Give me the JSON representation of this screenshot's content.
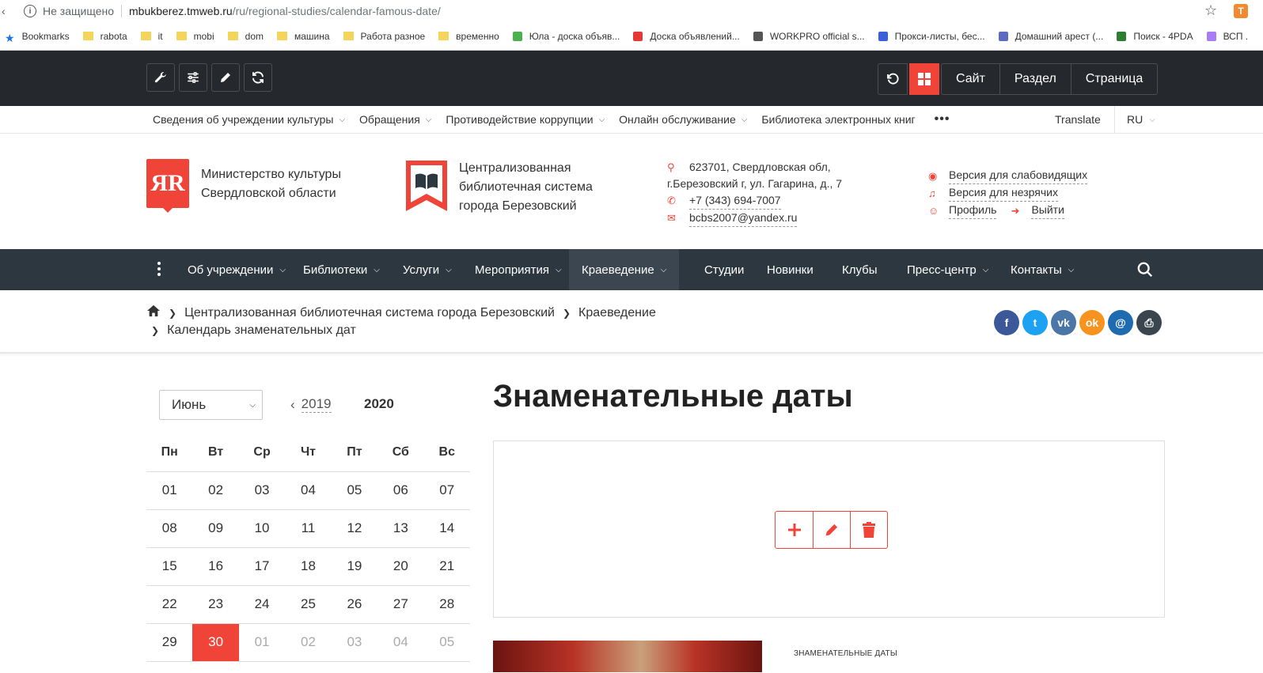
{
  "browser": {
    "insecure_label": "Не защищено",
    "url_host": "mbukberez.tmweb.ru",
    "url_path": "/ru/regional-studies/calendar-famous-date/",
    "extension_label": "T",
    "bookmarks": [
      {
        "label": "Bookmarks",
        "icon": "star-icon"
      },
      {
        "label": "rabota",
        "icon": "folder-icon"
      },
      {
        "label": "it",
        "icon": "folder-icon"
      },
      {
        "label": "mobi",
        "icon": "folder-icon"
      },
      {
        "label": "dom",
        "icon": "folder-icon"
      },
      {
        "label": "машина",
        "icon": "folder-icon"
      },
      {
        "label": "Работа разное",
        "icon": "folder-icon"
      },
      {
        "label": "временно",
        "icon": "folder-icon"
      },
      {
        "label": "Юла - доска объяв...",
        "icon": "sparkle-icon"
      },
      {
        "label": "Доска объявлений...",
        "icon": "dots-icon"
      },
      {
        "label": "WORKPRO official s...",
        "icon": "shield-icon"
      },
      {
        "label": "Прокси-листы, бес...",
        "icon": "badge-icon"
      },
      {
        "label": "Домашний арест (...",
        "icon": "bird-icon"
      },
      {
        "label": "Поиск - 4PDA",
        "icon": "doc-icon"
      },
      {
        "label": "ВСП .",
        "icon": "green-icon"
      }
    ]
  },
  "admin": {
    "seg_buttons": [
      "Сайт",
      "Раздел",
      "Страница"
    ]
  },
  "top_menu": {
    "items": [
      "Сведения об учреждении культуры",
      "Обращения",
      "Противодействие коррупции",
      "Онлайн обслуживание"
    ],
    "ebooks": "Библиотека электронных книг",
    "more": "•••",
    "translate": "Translate",
    "lang": "RU"
  },
  "header": {
    "logo_letters": "ЯR",
    "ministry_line1": "Министерство культуры",
    "ministry_line2": "Свердловской области",
    "cls_line1": "Централизованная",
    "cls_line2": "библиотечная система",
    "cls_line3": "города Березовский",
    "address_line1": "623701, Свердловская обл,",
    "address_line2": "г.Березовский г, ул. Гагарина, д., 7",
    "phone": "+7 (343) 694-7007",
    "email": "bcbs2007@yandex.ru",
    "low_vision": "Версия для слабовидящих",
    "hearing": "Версия для незрячих",
    "profile": "Профиль",
    "logout": "Выйти"
  },
  "nav": {
    "items": [
      {
        "label": "Об учреждении",
        "dropdown": true
      },
      {
        "label": "Библиотеки",
        "dropdown": true
      },
      {
        "label": "Услуги",
        "dropdown": true
      },
      {
        "label": "Мероприятия",
        "dropdown": true
      },
      {
        "label": "Краеведение",
        "dropdown": true,
        "active": true
      },
      {
        "label": "Студии",
        "dropdown": false
      },
      {
        "label": "Новинки",
        "dropdown": false
      },
      {
        "label": "Клубы",
        "dropdown": false
      },
      {
        "label": "Пресс-центр",
        "dropdown": true
      },
      {
        "label": "Контакты",
        "dropdown": true
      }
    ]
  },
  "breadcrumbs": {
    "level1": "Централизованная библиотечная система города Березовский",
    "level2": "Краеведение",
    "current": "Календарь знаменательных дат"
  },
  "share": [
    {
      "icon": "facebook-icon",
      "glyph": "f",
      "color": "#3b5998"
    },
    {
      "icon": "twitter-icon",
      "glyph": "t",
      "color": "#1da1f2"
    },
    {
      "icon": "vk-icon",
      "glyph": "vk",
      "color": "#4a76a8"
    },
    {
      "icon": "odnoklassniki-icon",
      "glyph": "ok",
      "color": "#f7931e"
    },
    {
      "icon": "mail-icon",
      "glyph": "@",
      "color": "#1f6bb0"
    },
    {
      "icon": "print-icon",
      "glyph": "⎙",
      "color": "#3a4550"
    }
  ],
  "calendar": {
    "month": "Июнь",
    "prev_year": "2019",
    "current_year": "2020",
    "weekdays": [
      "Пн",
      "Вт",
      "Ср",
      "Чт",
      "Пт",
      "Сб",
      "Вс"
    ],
    "weeks": [
      [
        "01",
        "02",
        "03",
        "04",
        "05",
        "06",
        "07"
      ],
      [
        "08",
        "09",
        "10",
        "11",
        "12",
        "13",
        "14"
      ],
      [
        "15",
        "16",
        "17",
        "18",
        "19",
        "20",
        "21"
      ],
      [
        "22",
        "23",
        "24",
        "25",
        "26",
        "27",
        "28"
      ],
      [
        "29",
        "30",
        "01",
        "02",
        "03",
        "04",
        "05"
      ]
    ],
    "today": "30"
  },
  "main": {
    "title": "Знаменательные даты",
    "tag": "ЗНАМЕНАТЕЛЬНЫЕ ДАТЫ"
  },
  "colors": {
    "accent": "#f04438",
    "admin_bg": "#25282c",
    "nav_bg": "#2d3740"
  }
}
